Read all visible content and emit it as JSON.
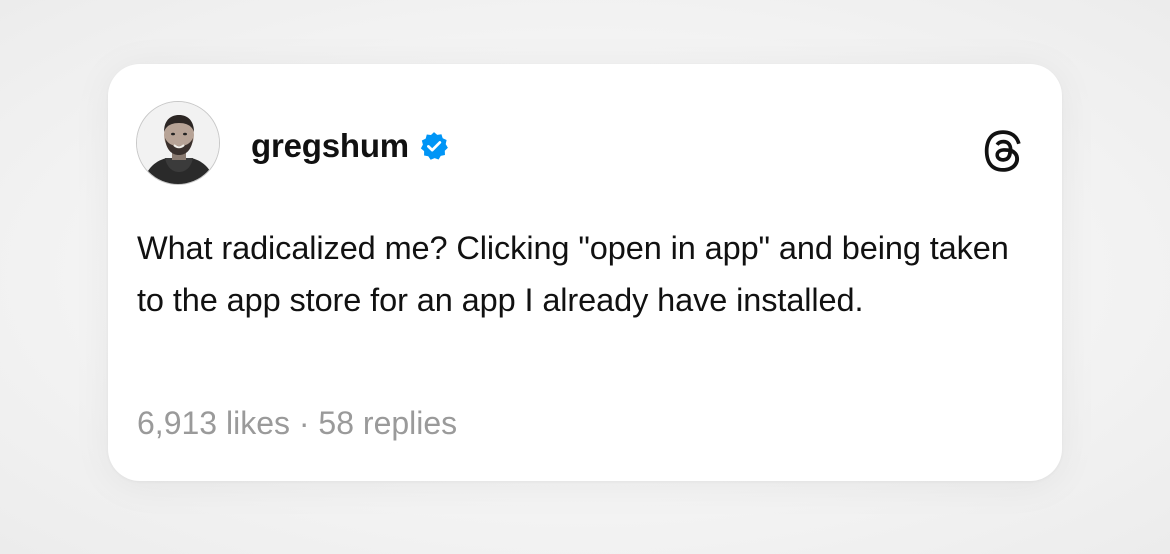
{
  "post": {
    "username": "gregshum",
    "verified": true,
    "text": "What radicalized me? Clicking \"open in app\" and being taken to the app store for an app I already have installed.",
    "likes": "6,913 likes",
    "separator": "·",
    "replies": "58 replies"
  },
  "icons": {
    "avatar": "user-avatar",
    "verified": "verified-badge-icon",
    "brand": "threads-logo-icon"
  },
  "colors": {
    "verified_badge": "#0095f6",
    "text": "#111111",
    "muted": "#9a9a9a",
    "card": "#ffffff",
    "background": "#ededed"
  }
}
